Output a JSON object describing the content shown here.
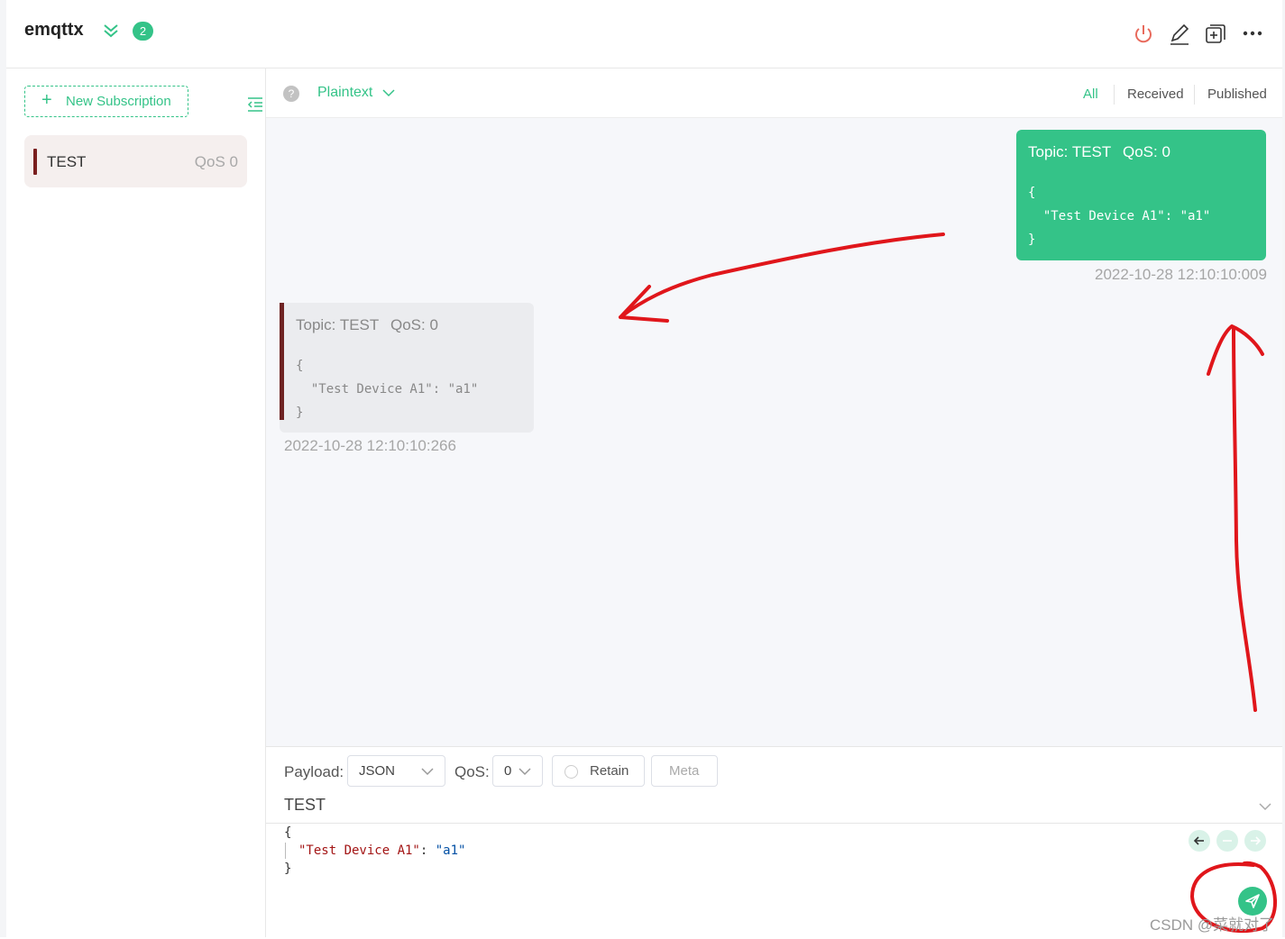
{
  "header": {
    "connection_name": "emqttx",
    "badge_count": "2",
    "icons": [
      "power-icon",
      "edit-icon",
      "new-window-icon",
      "more-icon"
    ]
  },
  "sidebar": {
    "new_subscription_label": "New Subscription",
    "subscriptions": [
      {
        "topic": "TEST",
        "qos": "QoS 0",
        "color": "#7a1f1f"
      }
    ]
  },
  "filter": {
    "format": "Plaintext",
    "tabs": [
      "All",
      "Received",
      "Published"
    ],
    "active_tab": "All"
  },
  "messages": [
    {
      "direction": "published",
      "topic_label": "Topic: TEST",
      "qos_label": "QoS: 0",
      "payload_lines": [
        "{",
        "  \"Test Device A1\": \"a1\"",
        "}"
      ],
      "timestamp": "2022-10-28 12:10:10:009"
    },
    {
      "direction": "received",
      "topic_label": "Topic: TEST",
      "qos_label": "QoS: 0",
      "payload_lines": [
        "{",
        "  \"Test Device A1\": \"a1\"",
        "}"
      ],
      "timestamp": "2022-10-28 12:10:10:266"
    }
  ],
  "publish": {
    "payload_label": "Payload:",
    "payload_type": "JSON",
    "qos_label": "QoS:",
    "qos_value": "0",
    "retain_label": "Retain",
    "meta_label": "Meta",
    "topic": "TEST",
    "editor": {
      "open": "{",
      "key": "\"Test Device A1\"",
      "sep": ": ",
      "value": "\"a1\"",
      "close": "}"
    }
  },
  "colors": {
    "accent": "#34c388",
    "subscription": "#7a1f1f",
    "annotation": "#e0161b"
  },
  "watermark": "CSDN @菜就对了"
}
